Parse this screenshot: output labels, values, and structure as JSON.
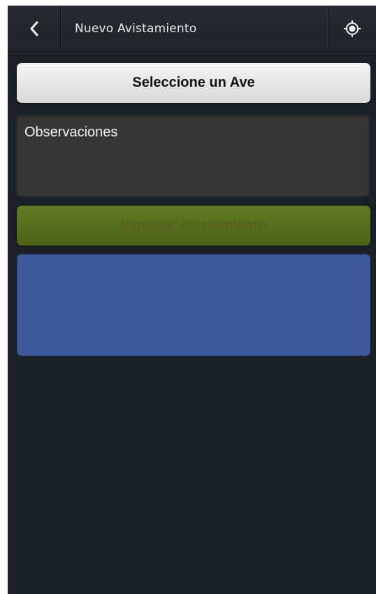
{
  "header": {
    "title": "Nuevo Avistamiento",
    "back_icon": "chevron-left-icon",
    "locate_icon": "crosshair-icon"
  },
  "form": {
    "select_bird_label": "Seleccione un Ave",
    "observations_placeholder": "Observaciones",
    "submit_label": "Ingresar Avistamiento"
  },
  "colors": {
    "background": "#1b2128",
    "header": "#23282d",
    "select_button": "#e8e8e8",
    "observations_bg": "#363636",
    "submit_button": "#566f1e",
    "blue_panel": "#3d5a9d"
  }
}
